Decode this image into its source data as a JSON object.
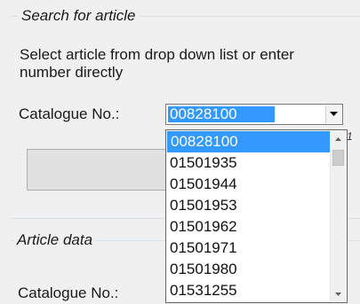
{
  "search_group": {
    "legend": "Search for article",
    "instruction": "Select article from drop down list or enter number directly",
    "catalogue_label": "Catalogue No.:",
    "combo_value": "00828100",
    "side_digit": "1"
  },
  "dropdown": {
    "items": [
      "00828100",
      "01501935",
      "01501944",
      "01501953",
      "01501962",
      "01501971",
      "01501980",
      "01531255"
    ],
    "selected_index": 0
  },
  "article_group": {
    "legend": "Article data",
    "catalogue_label": "Catalogue No.:"
  },
  "icons": {
    "combo_arrow": "chevron-down-icon",
    "scroll_up": "scroll-up-arrow-icon",
    "scroll_down": "scroll-down-arrow-icon"
  },
  "colors": {
    "selection": "#3399ff",
    "groupbox_line": "#d5dfe5"
  }
}
